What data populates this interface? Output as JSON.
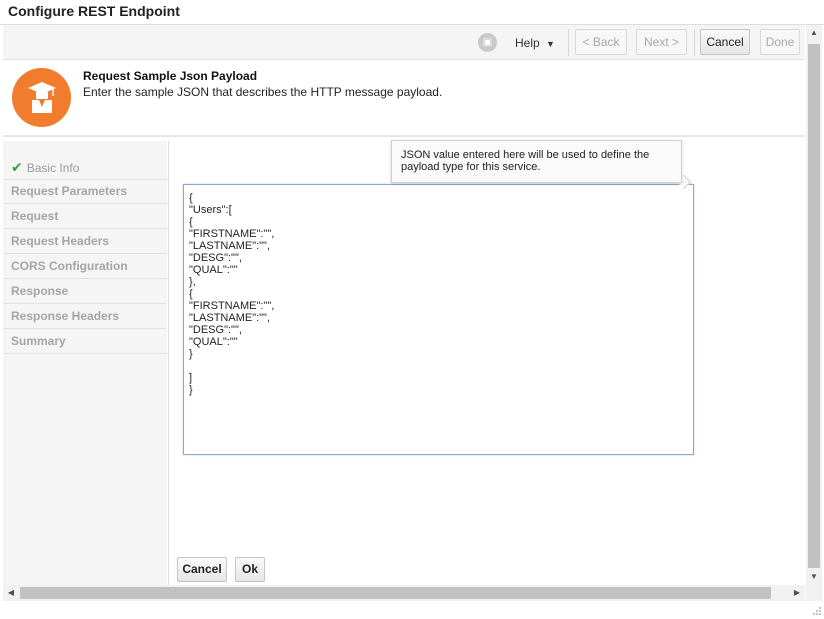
{
  "window": {
    "title": "Configure REST Endpoint"
  },
  "toolbar": {
    "status_icon": "lock-icon",
    "help_label": "Help",
    "back_label": "< Back",
    "next_label": "Next >",
    "cancel_label": "Cancel",
    "done_label": "Done"
  },
  "header": {
    "icon": "graduate-icon",
    "title": "Request Sample Json Payload",
    "description": "Enter the sample JSON that describes the HTTP message payload."
  },
  "nav": {
    "items": [
      {
        "label": "Basic Info",
        "icon": "check-icon"
      },
      {
        "label": "Request Parameters"
      },
      {
        "label": "Request"
      },
      {
        "label": "Request Headers"
      },
      {
        "label": "CORS Configuration"
      },
      {
        "label": "Response"
      },
      {
        "label": "Response Headers"
      },
      {
        "label": "Summary"
      }
    ]
  },
  "main": {
    "tooltip": "JSON value entered here will be used to define the payload type for this service.",
    "json_value": "{\n\"Users\":[\n{\n\"FIRSTNAME\":\"\",\n\"LASTNAME\":\"\",\n\"DESG\":\"\",\n\"QUAL\":\"\"\n},\n{\n\"FIRSTNAME\":\"\",\n\"LASTNAME\":\"\",\n\"DESG\":\"\",\n\"QUAL\":\"\"\n}\n\n]\n}",
    "cancel_label": "Cancel",
    "ok_label": "Ok"
  },
  "colors": {
    "accent": "#f27c2e",
    "check": "#3aa13a",
    "field_border": "#89a9d8"
  }
}
